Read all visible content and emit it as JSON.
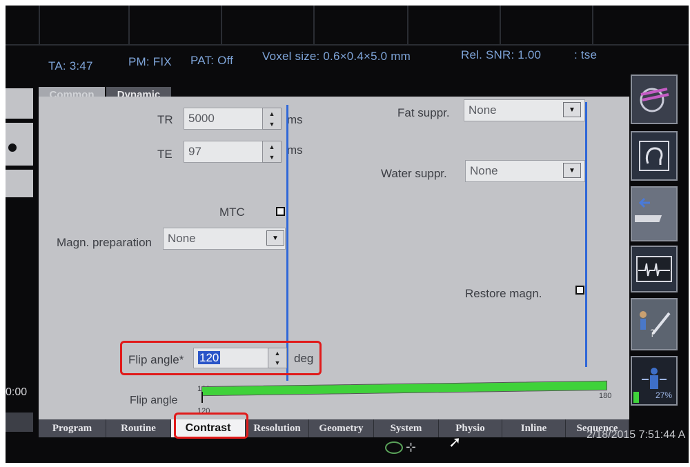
{
  "status": {
    "ta": "TA: 3:47",
    "pm": "PM: FIX",
    "pat": "PAT: Off",
    "voxel": "Voxel size: 0.6×0.4×5.0 mm",
    "snr": "Rel. SNR: 1.00",
    "seq": ": tse"
  },
  "top_tabs": {
    "common": "Common",
    "dynamic": "Dynamic"
  },
  "params": {
    "tr": {
      "label": "TR",
      "value": "5000",
      "unit": "ms"
    },
    "te": {
      "label": "TE",
      "value": "97",
      "unit": "ms"
    },
    "mtc": {
      "label": "MTC",
      "checked": false
    },
    "magn_prep": {
      "label": "Magn. preparation",
      "value": "None"
    },
    "fat_suppr": {
      "label": "Fat suppr.",
      "value": "None"
    },
    "water_suppr": {
      "label": "Water suppr.",
      "value": "None"
    },
    "restore_magn": {
      "label": "Restore magn.",
      "checked": false
    },
    "flip_angle": {
      "label": "Flip angle*",
      "value": "120",
      "unit": "deg"
    }
  },
  "flip_bar": {
    "label": "Flip angle",
    "current_label": "120",
    "below_label": "120",
    "max_label": "180",
    "fill_fraction": 1.0,
    "color": "#3fd23a"
  },
  "bottom_tabs": [
    "Program",
    "Routine",
    "Contrast",
    "Resolution",
    "Geometry",
    "System",
    "Physio",
    "Inline",
    "Sequence"
  ],
  "selected_tab": "Contrast",
  "side_meter": {
    "value": "27%"
  },
  "left_partial": {
    "time": "0:00"
  },
  "datetime": "2/18/2015 7:51:44 A",
  "colors": {
    "accent_line": "#2f67d8",
    "highlight": "#e01a1a",
    "status_text": "#7ea4d8",
    "selection": "#2a55c8"
  }
}
